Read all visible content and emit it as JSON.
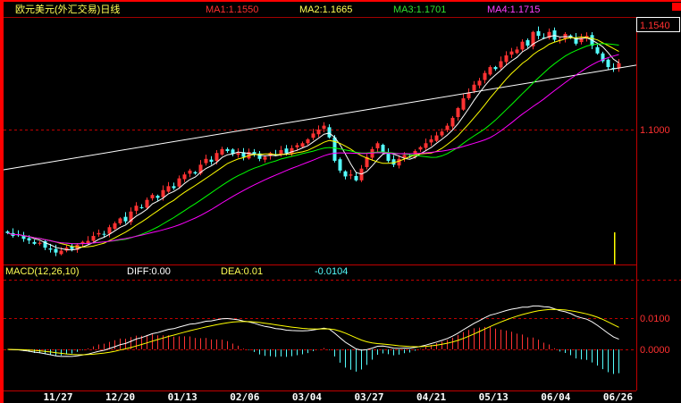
{
  "header": {
    "title": "欧元美元(外汇交易)日线",
    "ma1": "MA1:1.1550",
    "ma2": "MA2:1.1665",
    "ma3": "MA3:1.1701",
    "ma4": "MA4:1.1715",
    "colors": {
      "ma1": "#ff3030",
      "ma2": "#ffff54",
      "ma3": "#30e030",
      "ma4": "#ff40ff"
    }
  },
  "price_axis": {
    "current": "1.1540",
    "level": "1.1000"
  },
  "macd": {
    "label": "MACD(12,26,10)",
    "diff": "DIFF:0.00",
    "dea": "DEA:0.01",
    "macd_value": "-0.0104",
    "axis_high": "0.0100",
    "axis_zero": "0.0000"
  },
  "chart_data": {
    "type": "candlestick",
    "title": "欧元美元(外汇交易)日线",
    "x_tick_labels": [
      "11/27",
      "12/20",
      "01/13",
      "02/06",
      "03/04",
      "03/27",
      "04/21",
      "05/13",
      "06/04",
      "06/26"
    ],
    "price_reference_lines": [
      1.1,
      1.154
    ],
    "price_range": [
      1.031,
      1.1575
    ],
    "ma_periods": [
      5,
      10,
      20,
      30
    ],
    "line_colors": {
      "ma1": "#ffffff",
      "ma2": "#ffff00",
      "ma3": "#00ff00",
      "ma4": "#ff00ff"
    },
    "up_color": "#ff3232",
    "down_color": "#54fcfc",
    "trendline": {
      "start_price": 1.0794,
      "end_price": 1.133
    },
    "closes": [
      1.047,
      1.0455,
      1.0462,
      1.044,
      1.0432,
      1.0415,
      1.042,
      1.0395,
      1.0385,
      1.037,
      1.038,
      1.0395,
      1.0388,
      1.041,
      1.0425,
      1.043,
      1.0455,
      1.047,
      1.0462,
      1.05,
      1.052,
      1.0545,
      1.053,
      1.058,
      1.061,
      1.06,
      1.064,
      1.0665,
      1.065,
      1.069,
      1.071,
      1.07,
      1.075,
      1.077,
      1.079,
      1.0775,
      1.082,
      1.085,
      1.0835,
      1.088,
      1.09,
      1.089,
      1.0875,
      1.088,
      1.086,
      1.0885,
      1.087,
      1.085,
      1.086,
      1.088,
      1.087,
      1.0895,
      1.088,
      1.0905,
      1.092,
      1.093,
      1.095,
      1.098,
      1.1,
      1.102,
      1.096,
      1.084,
      1.079,
      1.076,
      1.077,
      1.074,
      1.08,
      1.086,
      1.09,
      1.093,
      1.088,
      1.084,
      1.082,
      1.085,
      1.087,
      1.086,
      1.089,
      1.091,
      1.093,
      1.095,
      1.097,
      1.099,
      1.102,
      1.106,
      1.111,
      1.116,
      1.119,
      1.123,
      1.125,
      1.129,
      1.132,
      1.131,
      1.135,
      1.138,
      1.14,
      1.141,
      1.145,
      1.143,
      1.15,
      1.148,
      1.147,
      1.15,
      1.146,
      1.146,
      1.149,
      1.147,
      1.144,
      1.147,
      1.148,
      1.143,
      1.139,
      1.135,
      1.132,
      1.131,
      1.134
    ],
    "macd_range": [
      -0.0135,
      0.0223
    ]
  }
}
